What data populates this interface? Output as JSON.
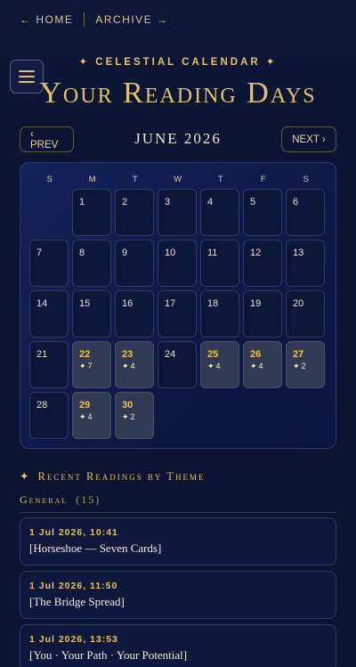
{
  "nav": {
    "home": "← HOME",
    "archive": "ARCHIVE →"
  },
  "header": {
    "eyebrow": "✦ CELESTIAL CALENDAR ✦",
    "title": "Your Reading Days"
  },
  "calendar": {
    "prev": "‹ PREV",
    "next": "NEXT ›",
    "month": "JUNE 2026",
    "weekdays": [
      "S",
      "M",
      "T",
      "W",
      "T",
      "F",
      "S"
    ],
    "days": [
      {
        "day": "1",
        "count": ""
      },
      {
        "day": "2",
        "count": ""
      },
      {
        "day": "3",
        "count": ""
      },
      {
        "day": "4",
        "count": ""
      },
      {
        "day": "5",
        "count": ""
      },
      {
        "day": "6",
        "count": ""
      },
      {
        "day": "7",
        "count": ""
      },
      {
        "day": "8",
        "count": ""
      },
      {
        "day": "9",
        "count": ""
      },
      {
        "day": "10",
        "count": ""
      },
      {
        "day": "11",
        "count": ""
      },
      {
        "day": "12",
        "count": ""
      },
      {
        "day": "13",
        "count": ""
      },
      {
        "day": "14",
        "count": ""
      },
      {
        "day": "15",
        "count": ""
      },
      {
        "day": "16",
        "count": ""
      },
      {
        "day": "17",
        "count": ""
      },
      {
        "day": "18",
        "count": ""
      },
      {
        "day": "19",
        "count": ""
      },
      {
        "day": "20",
        "count": ""
      },
      {
        "day": "21",
        "count": ""
      },
      {
        "day": "22",
        "count": "7"
      },
      {
        "day": "23",
        "count": "4"
      },
      {
        "day": "24",
        "count": ""
      },
      {
        "day": "25",
        "count": "4"
      },
      {
        "day": "26",
        "count": "4"
      },
      {
        "day": "27",
        "count": "2"
      },
      {
        "day": "28",
        "count": ""
      },
      {
        "day": "29",
        "count": "4"
      },
      {
        "day": "30",
        "count": "2"
      }
    ],
    "star_glyph": "✦"
  },
  "recent": {
    "heading": "Recent Readings by Theme",
    "heading_icon": "✦",
    "group_name": "General",
    "group_count": "(15)",
    "readings": [
      {
        "time": "1 Jul 2026, 10:41",
        "name": "[Horseshoe — Seven Cards]"
      },
      {
        "time": "1 Jul 2026, 11:50",
        "name": "[The Bridge Spread]"
      },
      {
        "time": "1 Jul 2026, 13:53",
        "name": "[You · Your Path · Your Potential]"
      }
    ]
  },
  "colors": {
    "accent": "#e4c066",
    "background": "#0c1636",
    "active_cell": "#303a52"
  }
}
